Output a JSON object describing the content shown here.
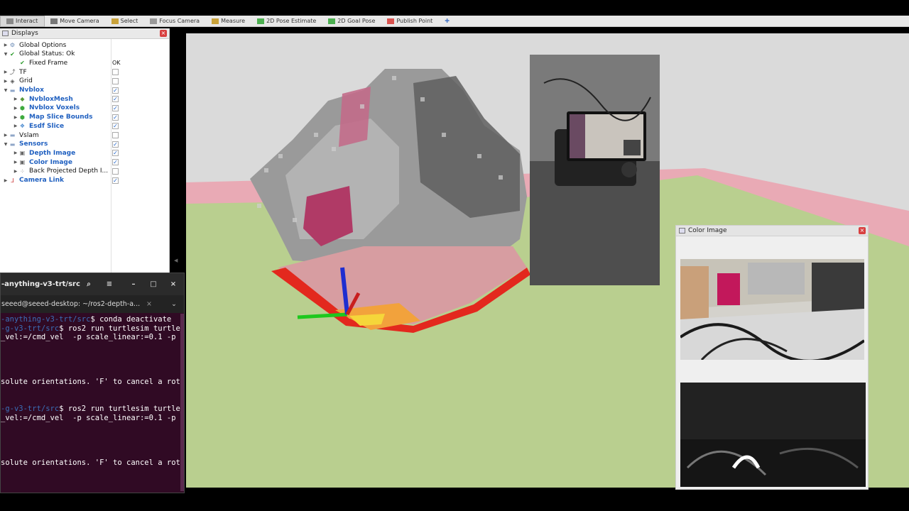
{
  "toolbar": {
    "tools": [
      {
        "label": "Interact",
        "icon": "interact-icon",
        "active": true
      },
      {
        "label": "Move Camera",
        "icon": "move-camera-icon"
      },
      {
        "label": "Select",
        "icon": "select-icon"
      },
      {
        "label": "Focus Camera",
        "icon": "focus-camera-icon"
      },
      {
        "label": "Measure",
        "icon": "measure-icon"
      },
      {
        "label": "2D Pose Estimate",
        "icon": "pose-estimate-icon"
      },
      {
        "label": "2D Goal Pose",
        "icon": "goal-pose-icon"
      },
      {
        "label": "Publish Point",
        "icon": "publish-point-icon"
      }
    ]
  },
  "displays": {
    "title": "Displays",
    "items": [
      {
        "label": "Global Options",
        "icon": "gear-icon",
        "indent": 0,
        "expandable": true
      },
      {
        "label": "Global Status: Ok",
        "icon": "check-icon",
        "indent": 0,
        "expanded": true
      },
      {
        "label": "Fixed Frame",
        "icon": "check-icon",
        "indent": 1,
        "value": "OK"
      },
      {
        "label": "TF",
        "icon": "tf-icon",
        "indent": 0,
        "expandable": true,
        "checked": false
      },
      {
        "label": "Grid",
        "icon": "grid-icon",
        "indent": 0,
        "expandable": true,
        "checked": false
      },
      {
        "label": "Nvblox",
        "icon": "folder-icon",
        "indent": 0,
        "expanded": true,
        "checked": true,
        "blue": true
      },
      {
        "label": "NvbloxMesh",
        "icon": "mesh-icon",
        "indent": 1,
        "expandable": true,
        "checked": true,
        "blue": true
      },
      {
        "label": "Nvblox Voxels",
        "icon": "voxel-icon",
        "indent": 1,
        "expandable": true,
        "checked": true,
        "blue": true
      },
      {
        "label": "Map Slice Bounds",
        "icon": "marker-icon",
        "indent": 1,
        "expandable": true,
        "checked": true,
        "blue": true
      },
      {
        "label": "Esdf Slice",
        "icon": "esdf-icon",
        "indent": 1,
        "expandable": true,
        "checked": true,
        "blue": true
      },
      {
        "label": "Vslam",
        "icon": "folder-icon",
        "indent": 0,
        "expandable": true,
        "checked": false
      },
      {
        "label": "Sensors",
        "icon": "folder-icon",
        "indent": 0,
        "expanded": true,
        "checked": true,
        "blue": true
      },
      {
        "label": "Depth Image",
        "icon": "image-icon",
        "indent": 1,
        "expandable": true,
        "checked": true,
        "blue": true
      },
      {
        "label": "Color Image",
        "icon": "image-icon",
        "indent": 1,
        "expandable": true,
        "checked": true,
        "blue": true
      },
      {
        "label": "Back Projected Depth I...",
        "icon": "pointcloud-icon",
        "indent": 1,
        "expandable": true,
        "checked": false
      },
      {
        "label": "Camera Link",
        "icon": "axes-icon",
        "indent": 0,
        "expandable": true,
        "checked": true,
        "blue": true
      }
    ]
  },
  "color_panel": {
    "title": "Color Image"
  },
  "terminal": {
    "title": "-anything-v3-trt/src",
    "tab": "seeed@seeed-desktop: ~/ros2-depth-a...",
    "lines": [
      {
        "path": "-anything-v3-trt/src",
        "text": "$ conda deactivate"
      },
      {
        "path": "-g-v3-trt/src",
        "text": "$ ros2 run turtlesim turtle_"
      },
      {
        "path": "",
        "text": "_vel:=/cmd_vel  -p scale_linear:=0.1 -p"
      },
      {
        "path": "",
        "text": "solute orientations. 'F' to cancel a rot"
      },
      {
        "path": "-g-v3-trt/src",
        "text": "$ ros2 run turtlesim turtle_"
      },
      {
        "path": "",
        "text": "_vel:=/cmd_vel  -p scale_linear:=0.1 -p"
      },
      {
        "path": "",
        "text": "solute orientations. 'F' to cancel a rot"
      }
    ]
  },
  "colors": {
    "ground": "#b9cf8f",
    "pink_band": "#e9aab5",
    "terminal_bg": "#300a24",
    "accent_blue": "#2060c0"
  }
}
